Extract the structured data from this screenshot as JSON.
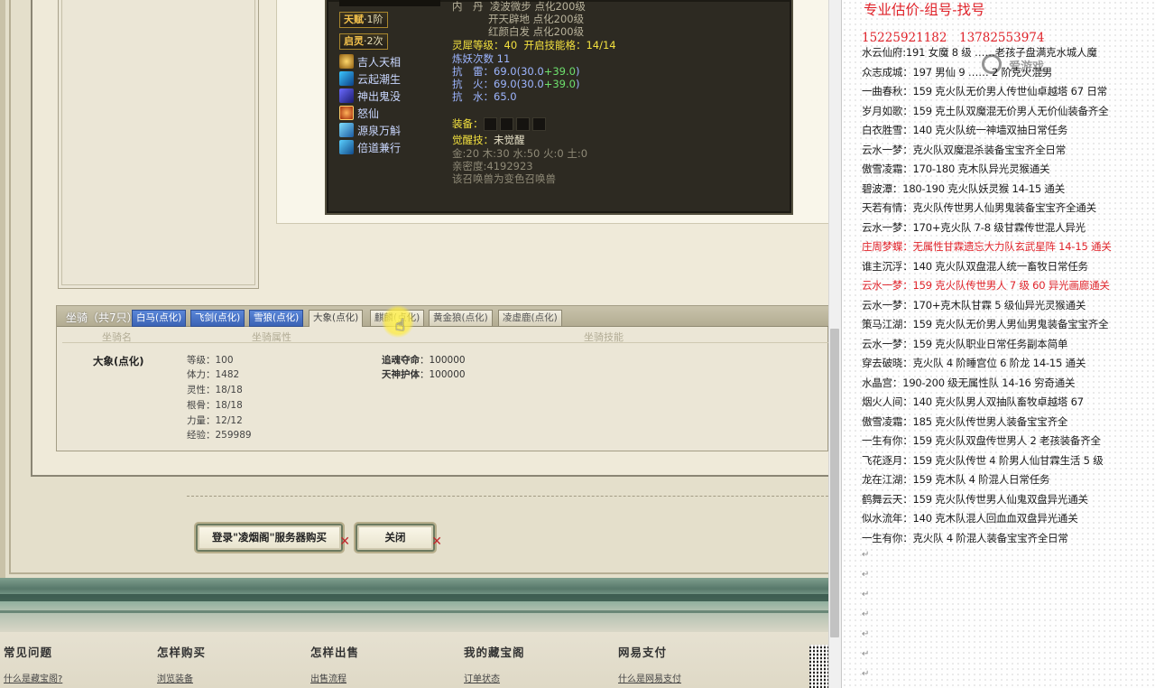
{
  "tooltip": {
    "badges": [
      {
        "label": "天赋",
        "value": "·1阶"
      },
      {
        "label": "启灵",
        "value": "·2次"
      }
    ],
    "skills": [
      "吉人天相",
      "云起潮生",
      "神出鬼没",
      "怒仙",
      "源泉万斛",
      "倍道兼行"
    ],
    "neidan_label": "内　丹",
    "neidan": [
      "凌波微步 点化200级",
      "开天辟地 点化200级",
      "红颜白发 点化200级"
    ],
    "lingxi_label": "灵犀等级：",
    "lingxi_value": "40",
    "lingxi_open": "开启技能格：",
    "lingxi_slots": "14/14",
    "lianyao": "炼妖次数 11",
    "kang_lei_label": "抗　雷：",
    "kang_lei_val": "69.0(30.0",
    "kang_lei_plus": "+39.0",
    "kang_huo_label": "抗　火：",
    "kang_huo_val": "69.0(30.0",
    "kang_huo_plus": "+39.0",
    "kang_shui_label": "抗　水：",
    "kang_shui_val": "65.0",
    "close_paren": ")",
    "equip_label": "装备：",
    "awaken_label": "觉醒技：",
    "awaken_value": "未觉醒",
    "elements": "金:20 木:30 水:50 火:0 土:0",
    "intimacy": "亲密度:4192923",
    "note": "该召唤兽为变色召唤兽"
  },
  "mount": {
    "title": "坐骑（共7只）",
    "tabs": [
      "白马(点化)",
      "飞剑(点化)",
      "雪狼(点化)",
      "大象(点化)",
      "麒麟(点化)",
      "黄金狼(点化)",
      "凌虚鹿(点化)"
    ],
    "col_name": "坐骑名",
    "col_attr": "坐骑属性",
    "col_skill": "坐骑技能",
    "name": "大象(点化)",
    "attrs": [
      "等级：100",
      "体力：1482",
      "灵性：18/18",
      "根骨：18/18",
      "力量：12/12",
      "经验：259989"
    ],
    "skills": [
      {
        "name": "追魂夺命",
        "value": "：100000"
      },
      {
        "name": "天神护体",
        "value": "：100000"
      }
    ]
  },
  "buttons": {
    "login_buy": "登录\"凌烟阁\"服务器购买",
    "close": "关闭"
  },
  "footer": {
    "cols": [
      {
        "title": "常见问题",
        "link": "什么是藏宝阁?"
      },
      {
        "title": "怎样购买",
        "link": "浏览装备"
      },
      {
        "title": "怎样出售",
        "link": "出售流程"
      },
      {
        "title": "我的藏宝阁",
        "link": "订单状态"
      },
      {
        "title": "网易支付",
        "link": "什么是网易支付"
      }
    ]
  },
  "notepad": {
    "title": "专业估价-组号-找号",
    "phones": "15225921182　13782553974",
    "watermark": "爱游戏",
    "lines": [
      {
        "text": "水云仙府:191 女魔 8 级 ……老孩子盘满克水城人魔",
        "red": false
      },
      {
        "text": "众志成城：197 男仙 9 …… 2 阶克火混男",
        "red": false
      },
      {
        "text": "一曲春秋：159 克火队无价男人传世仙卓越塔 67 日常",
        "red": false
      },
      {
        "text": "岁月如歌：159 克土队双魔混无价男人无价仙装备齐全",
        "red": false
      },
      {
        "text": "白衣胜雪：140 克火队统一神墙双抽日常任务",
        "red": false
      },
      {
        "text": "云水一梦：克火队双魔混杀装备宝宝齐全日常",
        "red": false
      },
      {
        "text": "傲雪凌霜：170-180 克木队异光灵猴通关",
        "red": false
      },
      {
        "text": "碧波潭：180-190 克火队妖灵猴 14-15 通关",
        "red": false
      },
      {
        "text": "天若有情：克火队传世男人仙男鬼装备宝宝齐全通关",
        "red": false
      },
      {
        "text": "云水一梦：170+克火队 7-8 级甘霖传世混人异光",
        "red": false
      },
      {
        "text": "庄周梦蝶：无属性甘霖遗忘大力队玄武星阵 14-15 通关",
        "red": true
      },
      {
        "text": "谁主沉浮：140 克火队双盘混人统一畜牧日常任务",
        "red": false
      },
      {
        "text": "云水一梦：159 克火队传世男人 7 级 60 异光画廊通关",
        "red": true
      },
      {
        "text": "云水一梦：170+克木队甘霖 5 级仙异光灵猴通关",
        "red": false
      },
      {
        "text": "策马江湖：159 克火队无价男人男仙男鬼装备宝宝齐全",
        "red": false
      },
      {
        "text": "云水一梦：159 克火队职业日常任务副本简单",
        "red": false
      },
      {
        "text": "穿去破晓：克火队 4 阶睡宫位 6 阶龙 14-15 通关",
        "red": false
      },
      {
        "text": "水晶宫：190-200 级无属性队 14-16 穷奇通关",
        "red": false
      },
      {
        "text": "烟火人间：140 克火队男人双抽队畜牧卓越塔 67",
        "red": false
      },
      {
        "text": "傲雪凌霜：185 克火队传世男人装备宝宝齐全",
        "red": false
      },
      {
        "text": "一生有你：159 克火队双盘传世男人 2 老孩装备齐全",
        "red": false
      },
      {
        "text": "飞花逐月：159 克火队传世 4 阶男人仙甘霖生活 5 级",
        "red": false
      },
      {
        "text": "龙在江湖：159 克木队 4 阶混人日常任务",
        "red": false
      },
      {
        "text": "鹤舞云天：159 克火队传世男人仙鬼双盘异光通关",
        "red": false
      },
      {
        "text": "似水流年：140 克木队混人回血血双盘异光通关",
        "red": false
      },
      {
        "text": "一生有你：克火队 4 阶混人装备宝宝齐全日常",
        "red": false
      }
    ],
    "return_mark": "↵"
  },
  "colors": {
    "red": "#e0232a",
    "tooltip_bg": "#2d2a22",
    "yellow": "#f2e03e",
    "light_blue": "#9db5ff"
  }
}
